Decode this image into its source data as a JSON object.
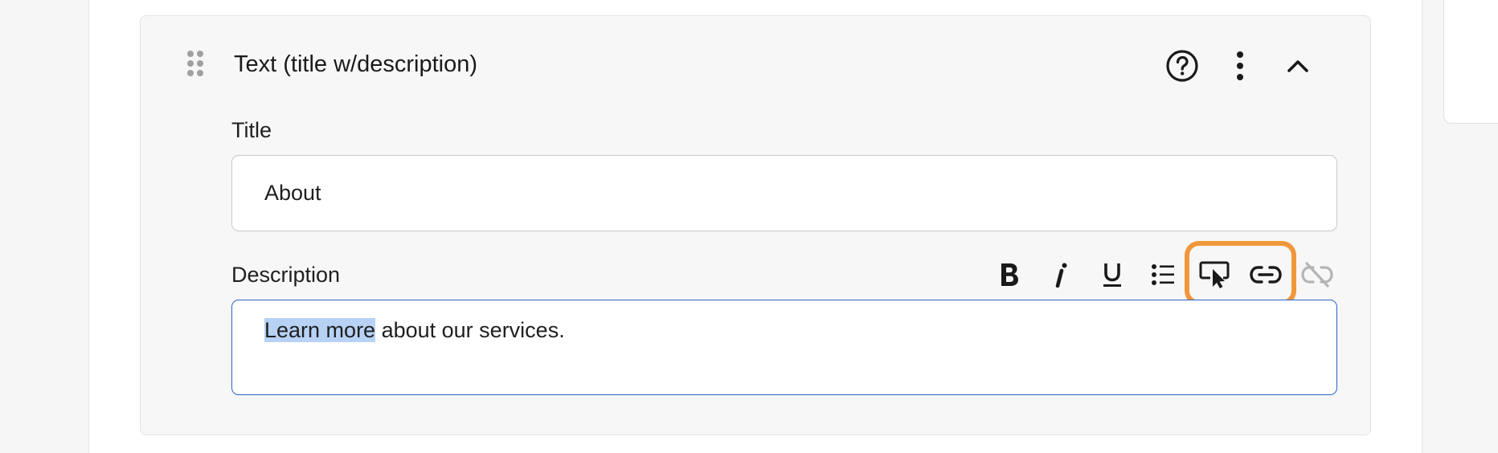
{
  "block": {
    "title": "Text (title w/description)",
    "icons": {
      "help": "help-circle-icon",
      "more": "more-vertical-icon",
      "collapse": "chevron-up-icon",
      "drag": "drag-handle-icon"
    }
  },
  "title_field": {
    "label": "Title",
    "value": "About"
  },
  "description_field": {
    "label": "Description",
    "selected_text": "Learn more",
    "rest_text": " about our services.",
    "toolbar": [
      "bold-icon",
      "italic-icon",
      "underline-icon",
      "bullet-list-icon",
      "insert-button-icon",
      "link-icon",
      "unlink-icon"
    ],
    "disabled_tools": [
      "unlink-icon"
    ]
  },
  "colors": {
    "highlight_outline": "#f0973a",
    "focus_border": "#2d63c8",
    "selection": "#b7d2f5"
  }
}
